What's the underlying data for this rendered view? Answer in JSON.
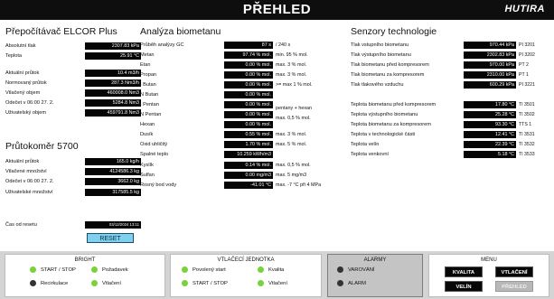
{
  "header": {
    "title": "PŘEHLED",
    "logo": "HUTIRA"
  },
  "elcor": {
    "title": "Přepočítávač ELCOR Plus",
    "rows": [
      {
        "label": "Absolutní tlak",
        "value": "2307.83 kPa"
      },
      {
        "label": "Teplota",
        "value": "25.91 °C"
      },
      {
        "label": "Aktuální průtok",
        "value": "10.4 m3/h"
      },
      {
        "label": "Normovaný průtok",
        "value": "287.3 Nm3/h"
      },
      {
        "label": "Vtlačený objem",
        "value": "460008.0 Nm3"
      },
      {
        "label": "Odečet v 06:00  27.  2.",
        "value": "5284.8 Nm3"
      },
      {
        "label": "Uživatelský objem",
        "value": "459791.8 Nm3"
      }
    ]
  },
  "prutokomer": {
    "title": "Průtokoměr 5700",
    "rows": [
      {
        "label": "Aktuální průtok",
        "value": "165.0 kg/h"
      },
      {
        "label": "Vtlačené množství",
        "value": "4124586.3 kg"
      },
      {
        "label": "Odečet v 06:00  27.  2.",
        "value": "3662.0 kg"
      },
      {
        "label": "Uživatelské množství",
        "value": "317585.5 kg"
      }
    ],
    "reset_label": "Čas od resetu",
    "reset_value": "03/12/2024 13:11",
    "reset_button": "RESET"
  },
  "analyza": {
    "title": "Analýza biometanu",
    "rows": [
      {
        "label": "Průběh analýzy GC",
        "value": "87 s",
        "note": "/ 240 s"
      },
      {
        "label": "Metan",
        "value": "97.74 % mol.",
        "note": "min. 95 % mol."
      },
      {
        "label": "Etan",
        "value": "0.00 % mol.",
        "note": "max. 3 % mol."
      },
      {
        "label": "Propan",
        "value": "0.00 % mol.",
        "note": "max. 3 % mol."
      },
      {
        "label": "I Butan",
        "value": "0.00 % mol.",
        "note": ">= max 1 % mol."
      },
      {
        "label": "N Butan",
        "value": "0.00 % mol.",
        "note": ""
      },
      {
        "label": "I Pentan",
        "value": "0.00 % mol.",
        "note": "pentany + hexan"
      },
      {
        "label": "N Pentan",
        "value": "0.00 % mol.",
        "note": "max. 0,5 % mol."
      },
      {
        "label": "Hexan",
        "value": "0.00 % mol.",
        "note": ""
      },
      {
        "label": "Dusík",
        "value": "0.55 % mol.",
        "note": "max. 3 % mol."
      },
      {
        "label": "Oxid uhličitý",
        "value": "1.70 % mol.",
        "note": "max. 5 % mol."
      },
      {
        "label": "Spalné teplo",
        "value": "10.259 kWh/m3",
        "note": ""
      },
      {
        "label": "Kyslík",
        "value": "0.14 % mol.",
        "note": "max. 0,5 % mol."
      },
      {
        "label": "Sulfan",
        "value": "0.00 mg/m3",
        "note": "max. 5 mg/m3"
      },
      {
        "label": "Rosný bod vody",
        "value": "-41.01 °C",
        "note": "max. -7 °C při 4 MPa"
      }
    ]
  },
  "senzory": {
    "title": "Senzory technologie",
    "rows": [
      {
        "label": "Tlak vstupního biometanu",
        "value": "970.44 kPa",
        "tag": "PI 3201"
      },
      {
        "label": "Tlak výstupního biometanu",
        "value": "2302.83 kPa",
        "tag": "PI 3202"
      },
      {
        "label": "Tlak biometanu před kompresorem",
        "value": "970.00 kPa",
        "tag": "PT 2"
      },
      {
        "label": "Tlak biometanu za kompresorem",
        "value": "2310.00 kPa",
        "tag": "PT 1"
      },
      {
        "label": "Tlak tlakového vzduchu",
        "value": "600.29 kPa",
        "tag": "PI 3221"
      },
      {
        "label": "Teplota biometanu před kompresorem",
        "value": "17.80 °C",
        "tag": "TI 3501"
      },
      {
        "label": "Teplota výstupního biometanu",
        "value": "25.28 °C",
        "tag": "TI 3502"
      },
      {
        "label": "Teplota biometanu za kompresorem",
        "value": "93.30 °C",
        "tag": "TTS 1"
      },
      {
        "label": "Teplota v technologické části",
        "value": "12.41 °C",
        "tag": "TI 3531"
      },
      {
        "label": "Teplota velín",
        "value": "22.39 °C",
        "tag": "TI 3532"
      },
      {
        "label": "Teplota venkovní",
        "value": "5.18 °C",
        "tag": "TI 3533"
      }
    ]
  },
  "bottom": {
    "bright": {
      "title": "BRIGHT",
      "items": [
        {
          "label": "START / STOP",
          "color": "green"
        },
        {
          "label": "Požadavek",
          "color": "green"
        },
        {
          "label": "Recirkulace",
          "color": "dark"
        },
        {
          "label": "Vtlačení",
          "color": "green"
        }
      ]
    },
    "vtlacovaci": {
      "title": "VTLAČECÍ JEDNOTKA",
      "items": [
        {
          "label": "Povolený start",
          "color": "green"
        },
        {
          "label": "Kvalita",
          "color": "green"
        },
        {
          "label": "START / STOP",
          "color": "green"
        },
        {
          "label": "Vtlačení",
          "color": "green"
        }
      ]
    },
    "alarmy": {
      "title": "ALARMY",
      "items": [
        {
          "label": "VAROVÁNÍ",
          "color": "dark"
        },
        {
          "label": "ALARM",
          "color": "dark"
        }
      ]
    },
    "menu": {
      "title": "MENU",
      "buttons": [
        {
          "label": "KVALITA",
          "state": "active"
        },
        {
          "label": "VTLAČENÍ",
          "state": "active"
        },
        {
          "label": "VELÍN",
          "state": "active"
        },
        {
          "label": "PŘEHLED",
          "state": "current"
        }
      ]
    }
  },
  "colors": {
    "indicator_green": "#7ad13a",
    "indicator_off": "#333333",
    "reset_button": "#7fd0ee"
  }
}
